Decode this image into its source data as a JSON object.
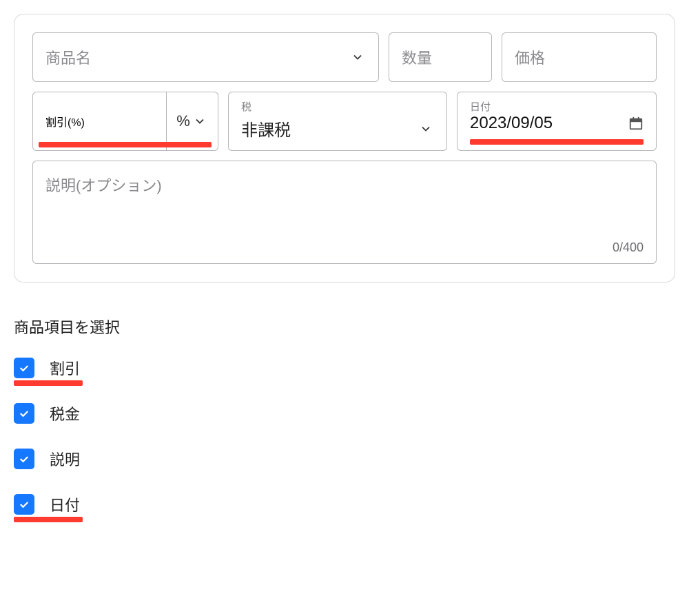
{
  "form": {
    "product_placeholder": "商品名",
    "quantity_placeholder": "数量",
    "price_placeholder": "価格",
    "discount_placeholder": "割引(%)",
    "discount_unit": "%",
    "tax_label": "税",
    "tax_value": "非課税",
    "date_label": "日付",
    "date_value": "2023/09/05",
    "description_placeholder": "説明(オプション)",
    "description_counter": "0/400"
  },
  "section_title": "商品項目を選択",
  "options": {
    "discount": {
      "label": "割引",
      "checked": true
    },
    "tax": {
      "label": "税金",
      "checked": true
    },
    "description": {
      "label": "説明",
      "checked": true
    },
    "date": {
      "label": "日付",
      "checked": true
    }
  }
}
